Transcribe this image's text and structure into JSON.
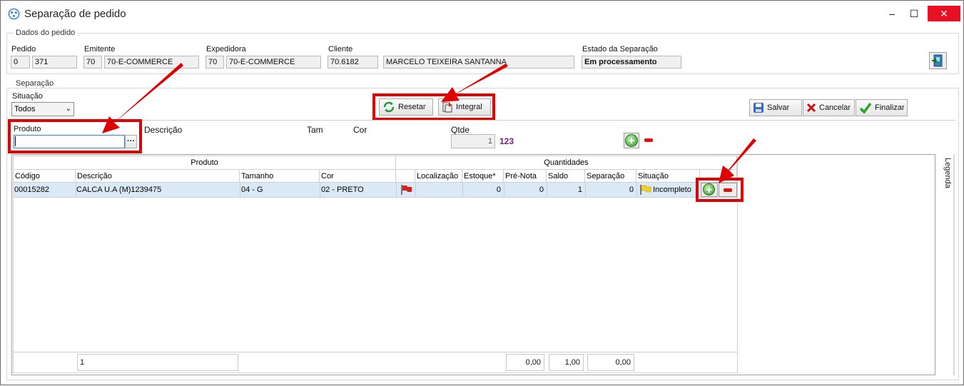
{
  "window": {
    "title": "Separação de pedido",
    "minimize": "–",
    "maximize": "☐",
    "close": "✕"
  },
  "pedido_group": {
    "legend": "Dados do pedido",
    "pedido_label": "Pedido",
    "pedido_a": "0",
    "pedido_b": "371",
    "emitente_label": "Emitente",
    "emitente_code": "70",
    "emitente_name": "70-E-COMMERCE",
    "expedidora_label": "Expedidora",
    "expedidora_code": "70",
    "expedidora_name": "70-E-COMMERCE",
    "cliente_label": "Cliente",
    "cliente_code": "70.6182",
    "cliente_name": "MARCELO TEIXEIRA SANTANNA",
    "estado_label": "Estado da Separação",
    "estado_value": "Em processamento"
  },
  "separacao_group": {
    "legend": "Separação",
    "situacao_label": "Situação",
    "situacao_value": "Todos",
    "resetar_label": "Resetar",
    "integral_label": "Integral",
    "salvar_label": "Salvar",
    "cancelar_label": "Cancelar",
    "finalizar_label": "Finalizar",
    "produto_label": "Produto",
    "produto_value": "",
    "browse_label": "···",
    "descricao_label": "Descrição",
    "tam_label": "Tam",
    "cor_label": "Cor",
    "qtde_label": "Qtde",
    "qtde_value": "1",
    "qtde_badge": "123"
  },
  "grid": {
    "band_produto": "Produto",
    "band_quantidades": "Quantidades",
    "columns": [
      "Código",
      "Descrição",
      "Tamanho",
      "Cor",
      "",
      "Localização",
      "Estoque*",
      "Pré-Nota",
      "Saldo",
      "Separação",
      "Situação"
    ],
    "rows": [
      {
        "codigo": "00015282",
        "descricao": "CALCA U.A (M)1239475",
        "tamanho": "04 - G",
        "cor": "02 - PRETO",
        "localizacao": "",
        "estoque": "0",
        "pre_nota": "0",
        "saldo": "1",
        "separacao": "0",
        "situacao": "Incompleto"
      }
    ],
    "footer": {
      "count": "1",
      "pre_nota_total": "0,00",
      "saldo_total": "1,00",
      "separacao_total": "0,00"
    },
    "side_tab": "Legenda"
  },
  "colors": {
    "highlight_red": "#e00000",
    "row_selected": "#dbe9f7",
    "qty_badge": "#7a1a7a"
  },
  "icons": [
    "app-icon",
    "refresh-icon",
    "integral-icon",
    "save-icon",
    "cancel-x-icon",
    "check-icon",
    "plus-circle-icon",
    "minus-icon",
    "red-flag-icon",
    "yellow-flag-icon",
    "exit-door-icon"
  ]
}
